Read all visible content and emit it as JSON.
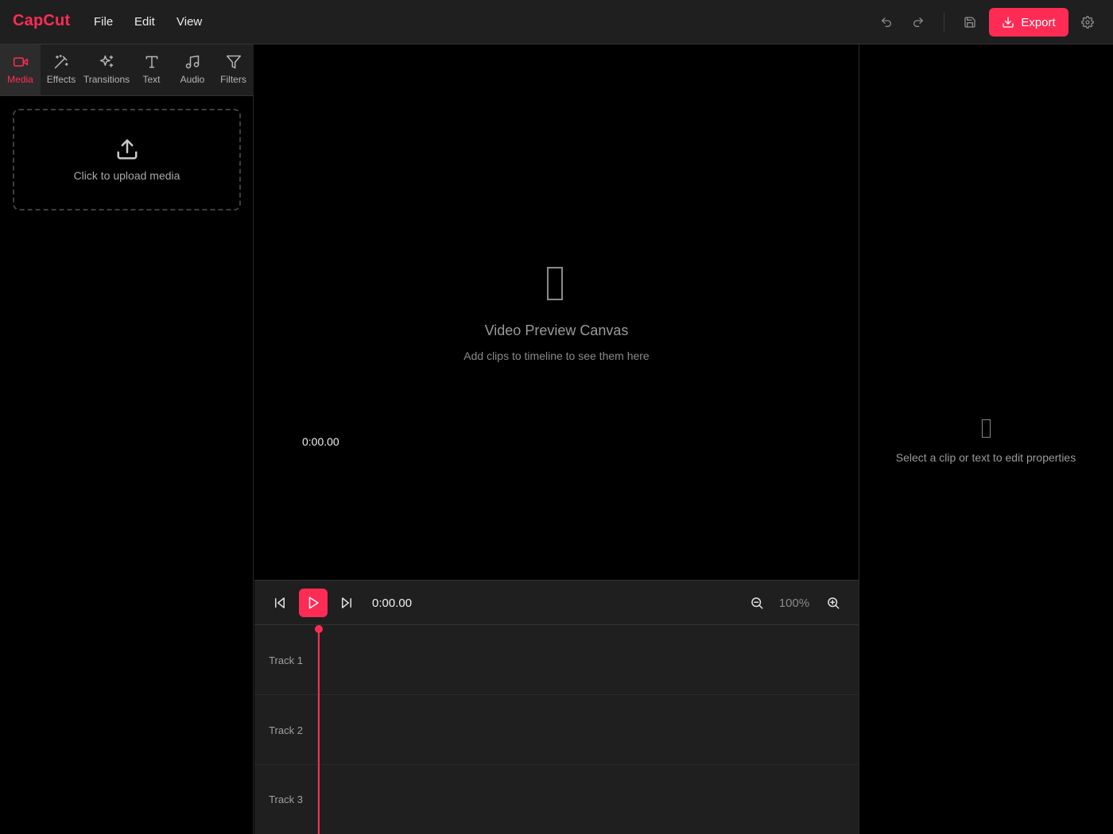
{
  "app": {
    "name": "CapCut",
    "brand_color": "#fe2c55"
  },
  "menu": {
    "file": "File",
    "edit": "Edit",
    "view": "View"
  },
  "toolbar": {
    "undo_icon": "undo-icon",
    "redo_icon": "redo-icon",
    "save_icon": "save-icon",
    "export_label": "Export",
    "settings_icon": "gear-icon"
  },
  "tools": [
    {
      "label": "Media",
      "icon": "video-camera-icon",
      "active": true
    },
    {
      "label": "Effects",
      "icon": "magic-wand-icon",
      "active": false
    },
    {
      "label": "Transitions",
      "icon": "sparkles-icon",
      "active": false
    },
    {
      "label": "Text",
      "icon": "type-icon",
      "active": false
    },
    {
      "label": "Audio",
      "icon": "music-note-icon",
      "active": false
    },
    {
      "label": "Filters",
      "icon": "filter-icon",
      "active": false
    }
  ],
  "upload": {
    "label": "Click to upload media",
    "icon": "upload-icon"
  },
  "preview": {
    "title": "Video Preview Canvas",
    "subtitle": "Add clips to timeline to see them here",
    "time": "0:00.00"
  },
  "properties": {
    "placeholder": "Select a clip or text to edit properties"
  },
  "playback": {
    "time": "0:00.00",
    "zoom": "100%"
  },
  "timeline": {
    "tracks": [
      {
        "label": "Track 1"
      },
      {
        "label": "Track 2"
      },
      {
        "label": "Track 3"
      }
    ],
    "playhead_time": "0:00.00"
  }
}
